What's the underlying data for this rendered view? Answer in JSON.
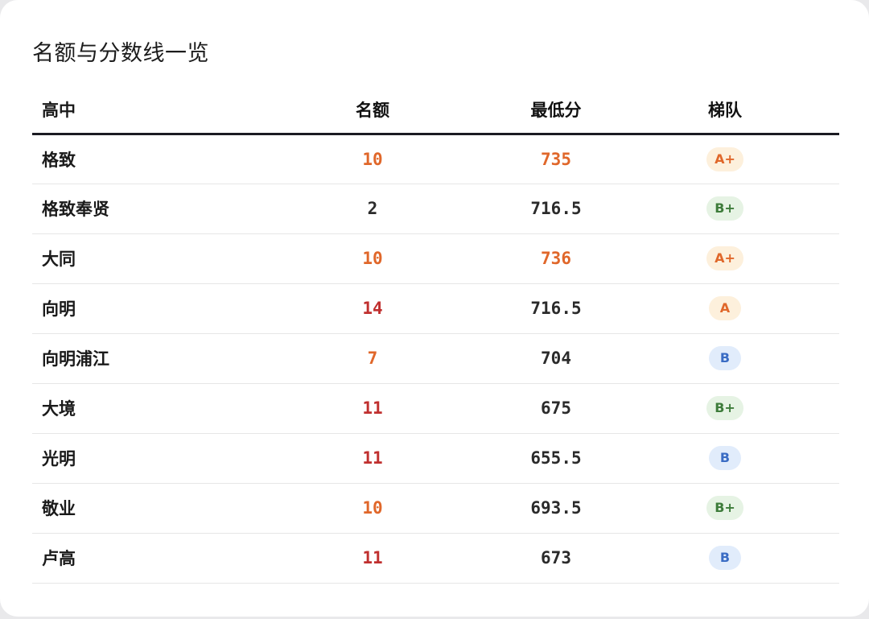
{
  "title": "名额与分数线一览",
  "columns": {
    "school": "高中",
    "quota": "名额",
    "min_score": "最低分",
    "tier": "梯队"
  },
  "colors": {
    "orange": "#e0672a",
    "red": "#c0302f",
    "dark": "#2b2b2b",
    "tier_A_bg": "#fdf0dc",
    "tier_A_fg": "#e0672a",
    "tier_B_plus_bg": "#e6f3e4",
    "tier_B_plus_fg": "#3d7c3a",
    "tier_B_bg": "#e1ecfb",
    "tier_B_fg": "#3a6cc4"
  },
  "rows": [
    {
      "school": "格致",
      "quota": "10",
      "quota_color": "orange",
      "min_score": "735",
      "score_color": "orange",
      "tier": "A+",
      "tier_style": "A"
    },
    {
      "school": "格致奉贤",
      "quota": "2",
      "quota_color": "dark",
      "min_score": "716.5",
      "score_color": "dark",
      "tier": "B+",
      "tier_style": "B_plus"
    },
    {
      "school": "大同",
      "quota": "10",
      "quota_color": "orange",
      "min_score": "736",
      "score_color": "orange",
      "tier": "A+",
      "tier_style": "A"
    },
    {
      "school": "向明",
      "quota": "14",
      "quota_color": "red",
      "min_score": "716.5",
      "score_color": "dark",
      "tier": "A",
      "tier_style": "A"
    },
    {
      "school": "向明浦江",
      "quota": "7",
      "quota_color": "orange",
      "min_score": "704",
      "score_color": "dark",
      "tier": "B",
      "tier_style": "B"
    },
    {
      "school": "大境",
      "quota": "11",
      "quota_color": "red",
      "min_score": "675",
      "score_color": "dark",
      "tier": "B+",
      "tier_style": "B_plus"
    },
    {
      "school": "光明",
      "quota": "11",
      "quota_color": "red",
      "min_score": "655.5",
      "score_color": "dark",
      "tier": "B",
      "tier_style": "B"
    },
    {
      "school": "敬业",
      "quota": "10",
      "quota_color": "orange",
      "min_score": "693.5",
      "score_color": "dark",
      "tier": "B+",
      "tier_style": "B_plus"
    },
    {
      "school": "卢高",
      "quota": "11",
      "quota_color": "red",
      "min_score": "673",
      "score_color": "dark",
      "tier": "B",
      "tier_style": "B"
    }
  ]
}
